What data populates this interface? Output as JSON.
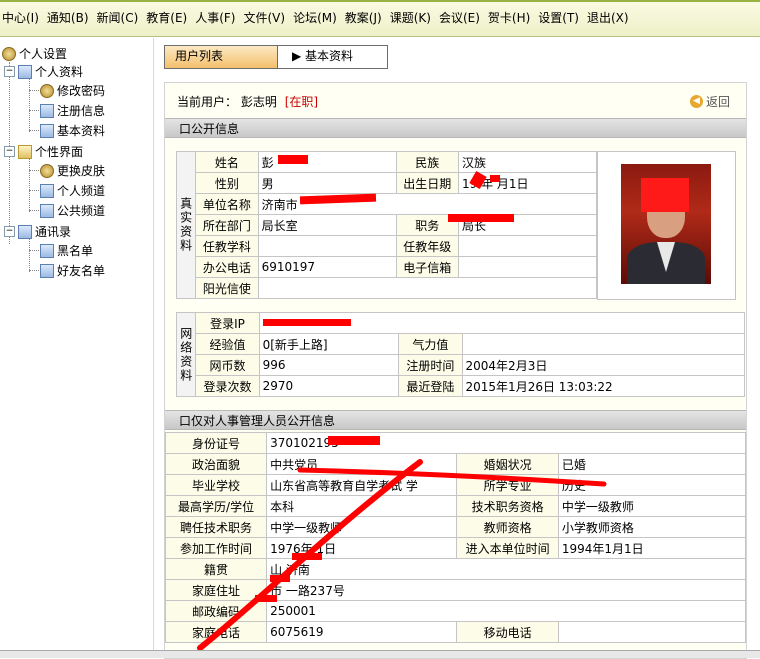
{
  "menu": [
    "中心(I)",
    "通知(B)",
    "新闻(C)",
    "教育(E)",
    "人事(F)",
    "文件(V)",
    "论坛(M)",
    "教案(J)",
    "课题(K)",
    "会议(E)",
    "贺卡(H)",
    "设置(T)",
    "退出(X)"
  ],
  "tree": {
    "root": "个人设置",
    "group1": "个人资料",
    "g1_items": [
      "修改密码",
      "注册信息",
      "基本资料"
    ],
    "group2": "个性界面",
    "g2_items": [
      "更换皮肤",
      "个人频道",
      "公共频道"
    ],
    "group3": "通讯录",
    "g3_items": [
      "黑名单",
      "好友名单"
    ]
  },
  "tabs": {
    "tab1": "用户列表",
    "tab2": "▶ 基本资料"
  },
  "current_user": {
    "label": "当前用户：",
    "name": "彭志明",
    "status": "[在职]"
  },
  "back": "返回",
  "public_section": "口公开信息",
  "real_info": {
    "vert": "真实资料",
    "rows": [
      [
        "姓名",
        "彭",
        "民族",
        "汉族"
      ],
      [
        "性别",
        "男",
        "出生日期",
        "19 年 月1日"
      ],
      [
        "单位名称",
        "济南市",
        null,
        null
      ],
      [
        "所在部门",
        "局长室",
        "职务",
        "局长"
      ],
      [
        "任教学科",
        "",
        "任教年级",
        ""
      ],
      [
        "办公电话",
        "6910197",
        "电子信箱",
        ""
      ],
      [
        "阳光信使",
        "",
        null,
        null
      ]
    ]
  },
  "net_info": {
    "vert": "网络资料",
    "rows": [
      [
        "登录IP",
        "",
        null,
        null
      ],
      [
        "经验值",
        "0[新手上路]",
        "气力值",
        ""
      ],
      [
        "网币数",
        "996",
        "注册时间",
        "2004年2月3日"
      ],
      [
        "登录次数",
        "2970",
        "最近登陆",
        "2015年1月26日 13:03:22"
      ]
    ]
  },
  "hr_section": "口仅对人事管理人员公开信息",
  "hr_info": {
    "rows": [
      [
        "身份证号",
        "370102195",
        null,
        null
      ],
      [
        "政治面貌",
        "中共党员",
        "婚姻状况",
        "已婚"
      ],
      [
        "毕业学校",
        "山东省高等教育自学考试 学",
        "所学专业",
        "历史"
      ],
      [
        "最高学历/学位",
        "本科",
        "技术职务资格",
        "中学一级教师"
      ],
      [
        "聘任技术职务",
        "中学一级教师",
        "教师资格",
        "小学教师资格"
      ],
      [
        "参加工作时间",
        "1976年 1日",
        "进入本单位时间",
        "1994年1月1日"
      ],
      [
        "籍贯",
        "山 济南",
        null,
        null
      ],
      [
        "家庭住址",
        "市 一路237号",
        null,
        null
      ],
      [
        "邮政编码",
        "250001",
        null,
        null
      ],
      [
        "家庭电话",
        "6075619",
        "移动电话",
        ""
      ]
    ]
  },
  "colors": {
    "menubar_line": "#97b240",
    "status_red": "#cc0000",
    "tab_active": "#f4c06c",
    "redaction": "#ff0000"
  }
}
